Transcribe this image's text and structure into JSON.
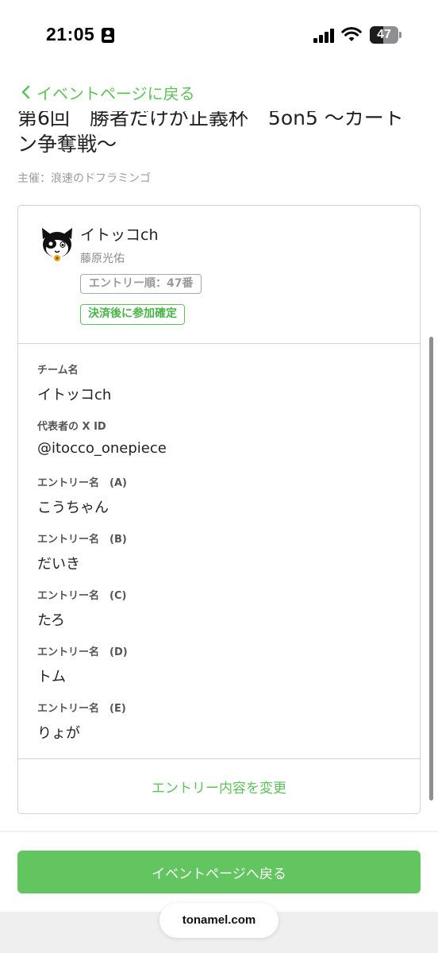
{
  "status_bar": {
    "time": "21:05",
    "battery_level": 47,
    "battery_label": "47",
    "icons": [
      "id-card-icon",
      "cellular-signal-icon",
      "wifi-icon",
      "battery-icon"
    ]
  },
  "nav": {
    "back_label": "イベントページに戻る",
    "back_icon": "chevron-left-icon"
  },
  "event": {
    "title": "第6回　勝者だけが正義杯　5on5 〜カートン争奪戦〜",
    "organizer": "主催：浪速のドフラミンゴ"
  },
  "entry": {
    "avatar_icon": "cat-avatar-icon",
    "team_name": "イトッコch",
    "leader_name": "藤原光佑",
    "order_badge": "エントリー順：47番",
    "status_badge": "決済後に参加確定",
    "fields": [
      {
        "label": "チーム名",
        "value": "イトッコch"
      },
      {
        "label": "代表者の X ID",
        "value": "@itocco_onepiece"
      },
      {
        "label": "エントリー名　(A)",
        "value": "こうちゃん"
      },
      {
        "label": "エントリー名　(B)",
        "value": "だいき"
      },
      {
        "label": "エントリー名　(C)",
        "value": "たろ"
      },
      {
        "label": "エントリー名　(D)",
        "value": "トム"
      },
      {
        "label": "エントリー名　(E)",
        "value": "りょが"
      }
    ],
    "change_label": "エントリー内容を変更"
  },
  "footer": {
    "return_button": "イベントページへ戻る",
    "url": "tonamel.com"
  },
  "colors": {
    "accent": "#5cc35a",
    "button_bg": "#63c55f",
    "border": "#d4d4d4",
    "muted_text": "#9a9a9a"
  }
}
